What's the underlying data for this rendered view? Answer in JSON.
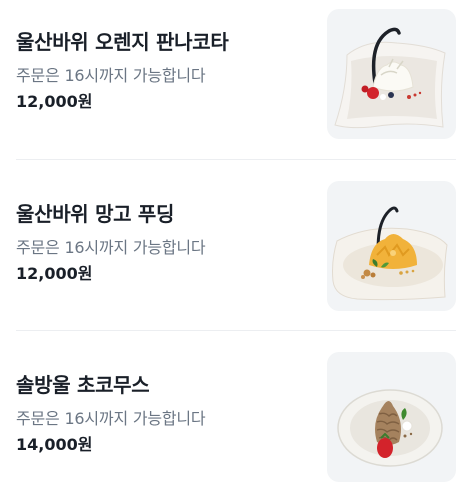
{
  "menu": {
    "items": [
      {
        "name": "울산바위 오렌지 판나코타",
        "note": "주문은 16시까지 가능합니다",
        "price": "12,000원",
        "image_icon": "panna-cotta-dessert-image"
      },
      {
        "name": "울산바위 망고 푸딩",
        "note": "주문은 16시까지 가능합니다",
        "price": "12,000원",
        "image_icon": "mango-pudding-dessert-image"
      },
      {
        "name": "솔방울 초코무스",
        "note": "주문은 16시까지 가능합니다",
        "price": "14,000원",
        "image_icon": "pinecone-chocolate-mousse-image"
      }
    ]
  },
  "colors": {
    "title": "#191f28",
    "note": "#6b7684",
    "thumb_bg": "#f2f4f6",
    "divider": "#eceef1"
  }
}
